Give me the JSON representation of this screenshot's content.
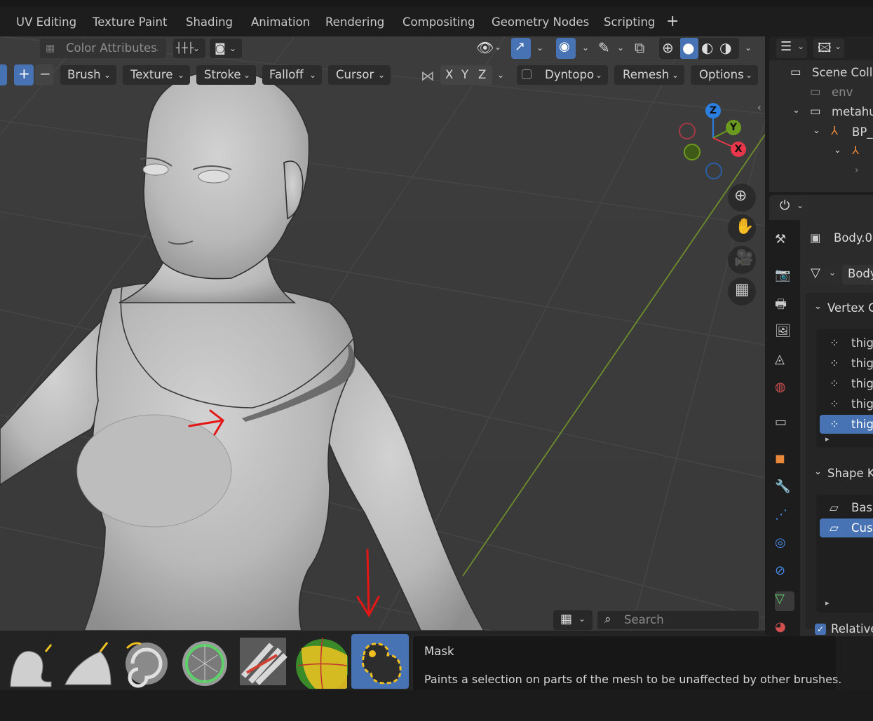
{
  "workspace_tabs": [
    "UV Editing",
    "Texture Paint",
    "Shading",
    "Animation",
    "Rendering",
    "Compositing",
    "Geometry Nodes",
    "Scripting"
  ],
  "header": {
    "color_attributes": "Color Attributes",
    "menus": {
      "brush": "Brush",
      "texture": "Texture",
      "stroke": "Stroke",
      "falloff": "Falloff",
      "cursor": "Cursor",
      "dyntopo": "Dyntopo",
      "remesh": "Remesh",
      "options": "Options"
    },
    "axes": {
      "x": "X",
      "y": "Y",
      "z": "Z"
    },
    "add_symbol": "+",
    "sub_symbol": "−"
  },
  "gizmo": {
    "x": "X",
    "y": "Y",
    "z": "Z"
  },
  "outliner": {
    "rows": {
      "scene": "Scene Colle",
      "env": "env",
      "metahu": "metahu",
      "bp": "BP_"
    }
  },
  "properties": {
    "object_name": "Body.0",
    "mesh_name": "Body",
    "vertex_groups_title": "Vertex G",
    "vertex_groups": [
      "thigh",
      "thigh",
      "thigh",
      "thigh",
      "thigh"
    ],
    "shape_keys_title": "Shape K",
    "shape_keys": [
      "Basi",
      "Cus"
    ],
    "relative_label": "Relative"
  },
  "toolbar": {
    "search_placeholder": "Search",
    "tools": [
      "draw",
      "clay-strips",
      "twist",
      "face-sets",
      "smooth",
      "grab-masked",
      "mask"
    ],
    "active_tool": "mask"
  },
  "tooltip": {
    "title": "Mask",
    "description": "Paints a selection on parts of the mesh to be unaffected by other brushes."
  },
  "colors": {
    "accent": "#4772b3",
    "viewport_bg": "#3d3d3d",
    "annotation_red": "#e41616",
    "axis_x": "#e8374a",
    "axis_y": "#6c9a1e",
    "axis_z": "#2b7fe0"
  }
}
